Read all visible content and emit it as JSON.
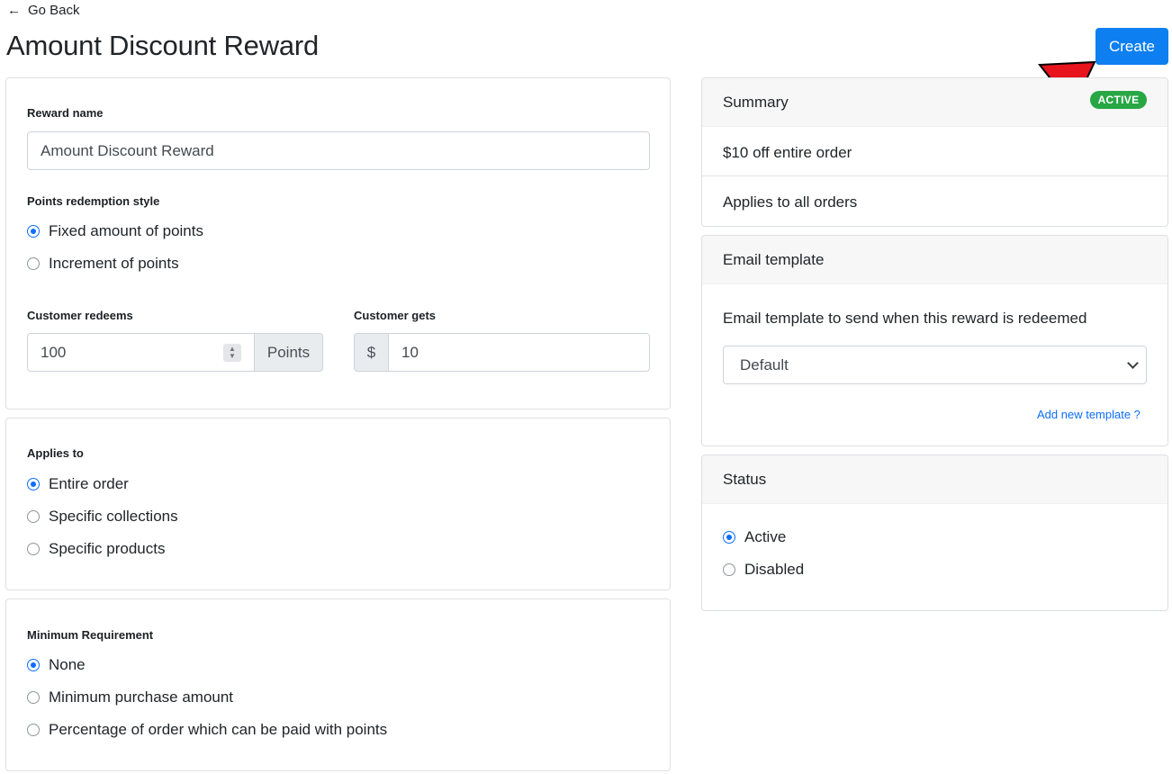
{
  "header": {
    "back_label": "Go Back",
    "title": "Amount Discount Reward",
    "create_label": "Create"
  },
  "reward_card": {
    "name_label": "Reward name",
    "name_value": "Amount Discount Reward",
    "style_label": "Points redemption style",
    "style_options": [
      "Fixed amount of points",
      "Increment of points"
    ],
    "style_selected": "Fixed amount of points",
    "redeems_label": "Customer redeems",
    "redeems_value": "100",
    "redeems_unit": "Points",
    "gets_label": "Customer gets",
    "gets_currency": "$",
    "gets_value": "10"
  },
  "applies_card": {
    "label": "Applies to",
    "options": [
      "Entire order",
      "Specific collections",
      "Specific products"
    ],
    "selected": "Entire order"
  },
  "minimum_card": {
    "label": "Minimum Requirement",
    "options": [
      "None",
      "Minimum purchase amount",
      "Percentage of order which can be paid with points"
    ],
    "selected": "None"
  },
  "summary_card": {
    "title": "Summary",
    "badge": "ACTIVE",
    "lines": [
      "$10 off entire order",
      "Applies to all orders"
    ]
  },
  "email_card": {
    "title": "Email template",
    "description": "Email template to send when this reward is redeemed",
    "selected_template": "Default",
    "add_link": "Add new template ?"
  },
  "status_card": {
    "title": "Status",
    "options": [
      "Active",
      "Disabled"
    ],
    "selected": "Active"
  },
  "colors": {
    "primary": "#0d7ff0",
    "badge_green": "#28a745",
    "annotation_arrow": "#e8141c"
  },
  "annotation": {
    "icon": "red-pointer-arrow-icon"
  }
}
